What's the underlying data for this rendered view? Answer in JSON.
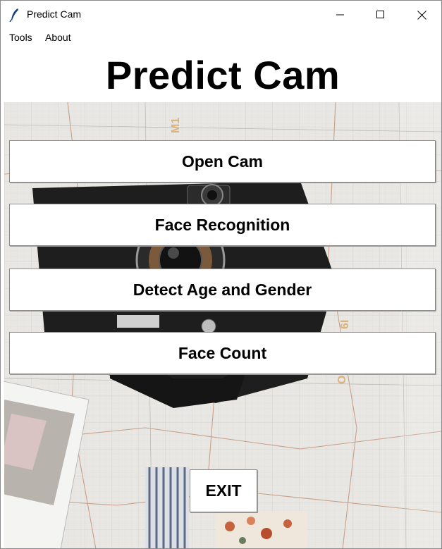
{
  "window": {
    "title": "Predict Cam",
    "icon": "feather-icon",
    "controls": [
      "minimize-icon",
      "maximize-icon",
      "close-icon"
    ]
  },
  "menu": {
    "items": [
      {
        "label": "Tools"
      },
      {
        "label": "About"
      }
    ]
  },
  "main": {
    "title": "Predict Cam",
    "buttons": [
      {
        "label": "Open Cam"
      },
      {
        "label": "Face Recognition"
      },
      {
        "label": "Detect Age and Gender"
      },
      {
        "label": "Face Count"
      }
    ],
    "exit_label": "EXIT"
  },
  "background": {
    "description_icons": [
      "map-background",
      "camera-image",
      "polaroid-photo",
      "fabric-swatch"
    ],
    "colors": {
      "map": "#e7e6e2",
      "camera": "#1f1f1f",
      "road": "#c9a08a"
    }
  }
}
